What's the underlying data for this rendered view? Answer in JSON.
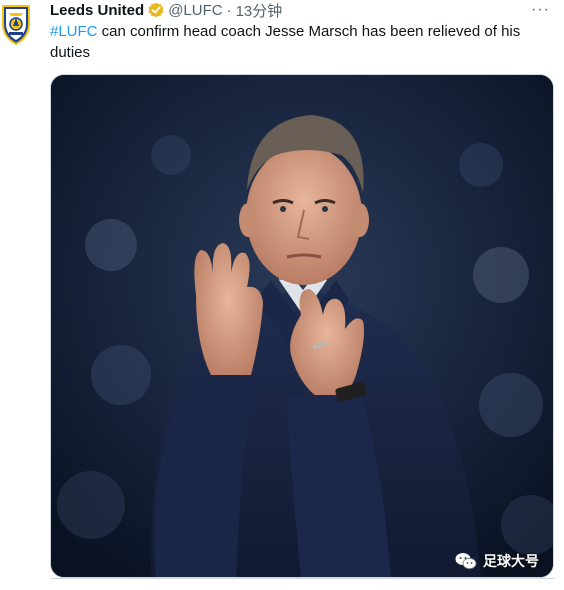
{
  "tweet": {
    "display_name": "Leeds United",
    "handle": "@LUFC",
    "separator": "·",
    "time": "13分钟",
    "more_label": "···",
    "hashtag": "#LUFC",
    "text": " can confirm head coach Jesse Marsch has been relieved of his duties",
    "avatar_icon": "leeds-united-crest-icon",
    "verified_icon": "gold-verified-badge-icon"
  },
  "media": {
    "watermark_text": "足球大号",
    "watermark_icon": "wechat-icon"
  },
  "colors": {
    "hashtag": "#1d9bf0",
    "verified": "#e8b923",
    "crest_yellow": "#f5c518",
    "crest_blue": "#1d428a"
  }
}
